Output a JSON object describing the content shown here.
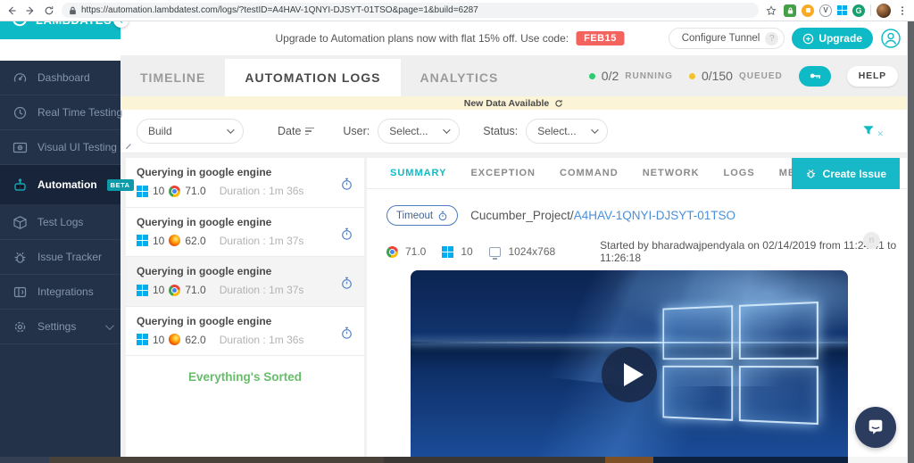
{
  "browser_chrome": {
    "url": "https://automation.lambdatest.com/logs/?testID=A4HAV-1QNYI-DJSYT-01TSO&page=1&build=6287",
    "extension_v": "V",
    "extension_g": "G"
  },
  "header": {
    "brand": "LAMBDATEST",
    "promo_text": "Upgrade to Automation plans now with flat 15% off. Use code:",
    "promo_code": "FEB15",
    "configure_tunnel_label": "Configure Tunnel",
    "help_mark": "?",
    "upgrade_label": "Upgrade"
  },
  "sidebar": {
    "items": [
      {
        "label": "Dashboard",
        "icon": "gauge",
        "active": false,
        "chevron": false
      },
      {
        "label": "Real Time Testing",
        "icon": "clock",
        "active": false,
        "chevron": false
      },
      {
        "label": "Visual UI Testing",
        "icon": "eye",
        "active": false,
        "chevron": true
      },
      {
        "label": "Automation",
        "icon": "robot",
        "active": true,
        "badge": "BETA",
        "chevron": false
      },
      {
        "label": "Test Logs",
        "icon": "cube",
        "active": false,
        "chevron": false
      },
      {
        "label": "Issue Tracker",
        "icon": "bug",
        "active": false,
        "chevron": false
      },
      {
        "label": "Integrations",
        "icon": "brackets",
        "active": false,
        "chevron": false
      },
      {
        "label": "Settings",
        "icon": "gear",
        "active": false,
        "chevron": true
      }
    ]
  },
  "top_tabs": {
    "items": [
      {
        "label": "TIMELINE",
        "active": false
      },
      {
        "label": "AUTOMATION LOGS",
        "active": true
      },
      {
        "label": "ANALYTICS",
        "active": false
      }
    ],
    "running_value": "0/2",
    "running_label": "Running",
    "queued_value": "0/150",
    "queued_label": "Queued",
    "help_label": "HELP"
  },
  "notice_bar": {
    "text": "New Data Available"
  },
  "filters": {
    "build_label": "Build",
    "date_label": "Date",
    "user_label": "User:",
    "user_value": "Select...",
    "status_label": "Status:",
    "status_value": "Select..."
  },
  "test_list": {
    "items": [
      {
        "title": "Querying in google engine",
        "os_version": "10",
        "browser": "chrome",
        "browser_version": "71.0",
        "duration": "Duration : 1m 36s",
        "selected": false
      },
      {
        "title": "Querying in google engine",
        "os_version": "10",
        "browser": "firefox",
        "browser_version": "62.0",
        "duration": "Duration : 1m 37s",
        "selected": false
      },
      {
        "title": "Querying in google engine",
        "os_version": "10",
        "browser": "chrome",
        "browser_version": "71.0",
        "duration": "Duration : 1m 37s",
        "selected": true
      },
      {
        "title": "Querying in google engine",
        "os_version": "10",
        "browser": "firefox",
        "browser_version": "62.0",
        "duration": "Duration : 1m 36s",
        "selected": false
      }
    ],
    "footer": "Everything's Sorted"
  },
  "detail": {
    "tabs": [
      {
        "label": "SUMMARY",
        "active": true
      },
      {
        "label": "EXCEPTION",
        "active": false
      },
      {
        "label": "COMMAND",
        "active": false
      },
      {
        "label": "NETWORK",
        "active": false
      },
      {
        "label": "LOGS",
        "active": false
      },
      {
        "label": "METADATA",
        "active": false
      }
    ],
    "create_issue_label": "Create Issue",
    "status_badge": "Timeout",
    "project_name": "Cucumber_Project/",
    "test_id": "A4HAV-1QNYI-DJSYT-01TSO",
    "browser_version": "71.0",
    "os_version": "10",
    "resolution": "1024x768",
    "started_text": "Started by bharadwajpendyala on 02/14/2019 from 11:24:41 to 11:26:18",
    "notification_glyph": "n"
  },
  "colors": {
    "teal": "#0ebac5",
    "promo_red": "#f4645f",
    "running_green": "#2ecc71",
    "queued_yellow": "#f3c32c",
    "link_blue": "#4a90d9",
    "sorted_green": "#67bd6a",
    "sidebar_navy": "#233248"
  }
}
